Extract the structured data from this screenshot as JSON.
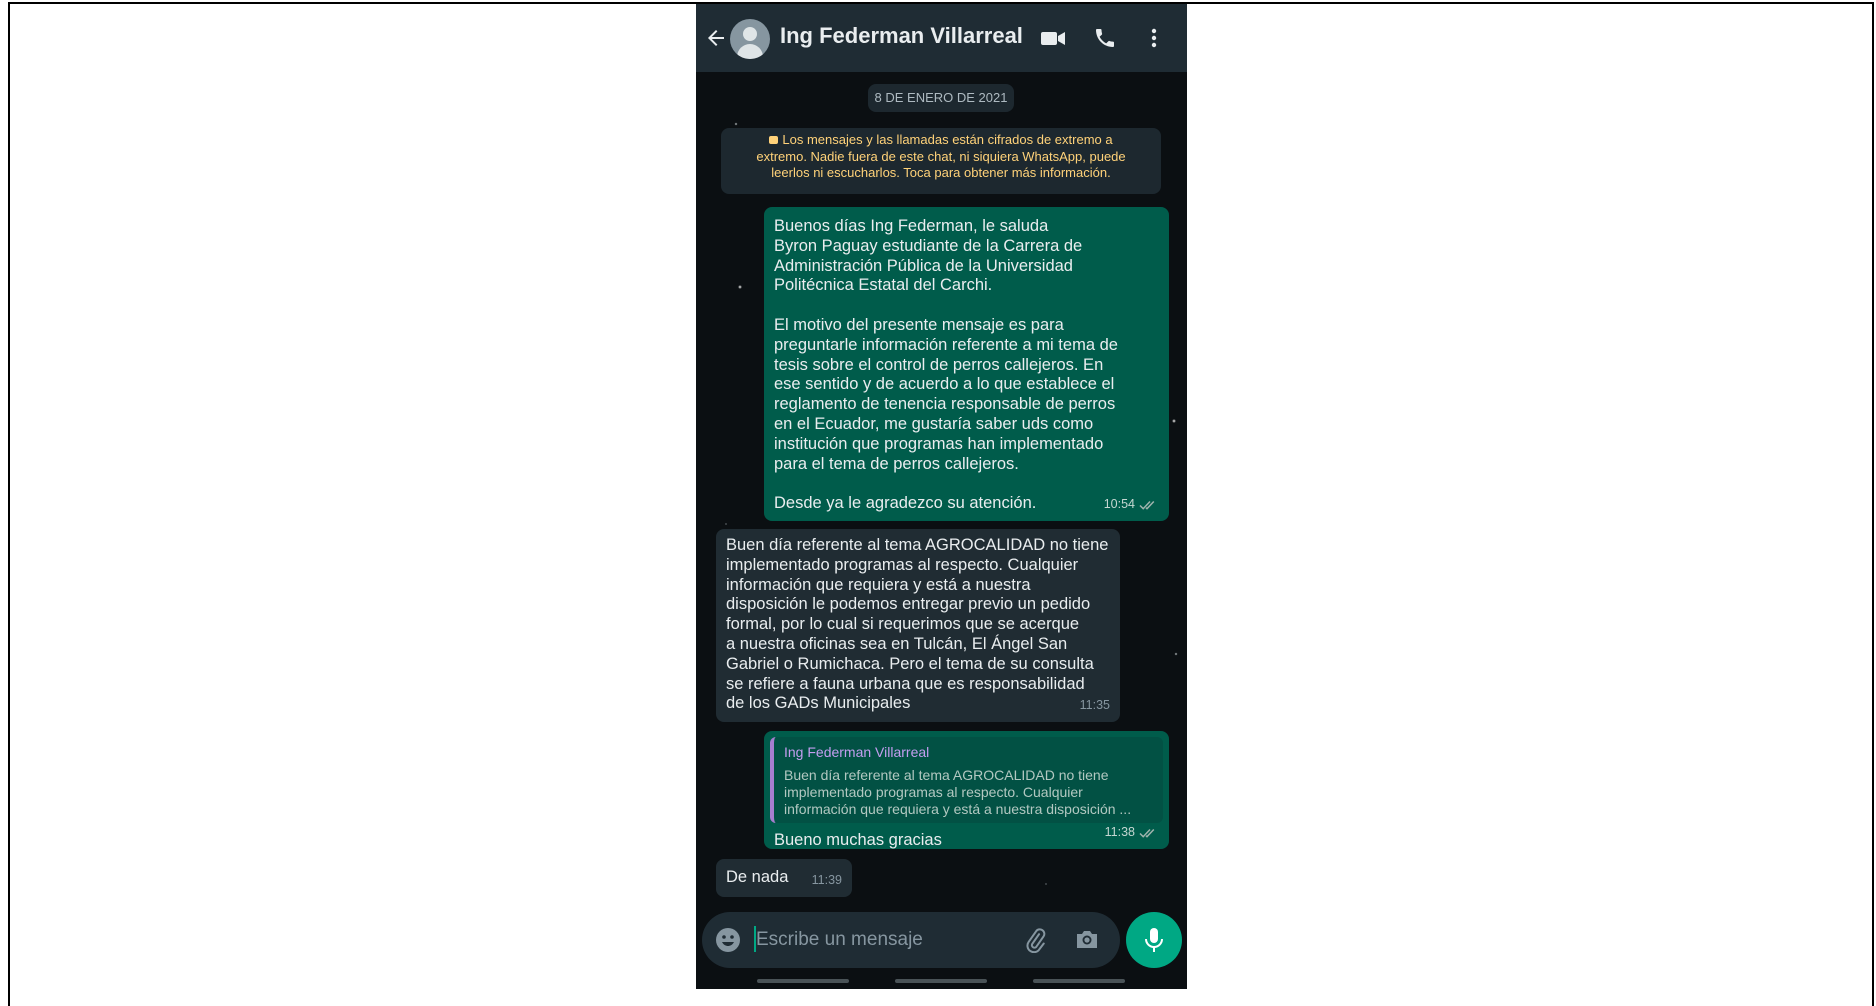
{
  "header": {
    "contact_name": "Ing Federman Villarreal",
    "back_icon": "arrow-left-icon",
    "video_icon": "video-call-icon",
    "call_icon": "phone-icon",
    "menu_icon": "more-vert-icon"
  },
  "chat": {
    "date_chip": "8 DE ENERO DE 2021",
    "encryption_notice": "Los mensajes y las llamadas están cifrados de extremo a\nextremo. Nadie fuera de este chat, ni siquiera WhatsApp, puede\nleerlos ni escucharlos. Toca para obtener más información.",
    "messages": [
      {
        "direction": "outgoing",
        "text": "Buenos días Ing Federman, le saluda\nByron Paguay estudiante de la Carrera de\nAdministración Pública de la Universidad\nPolitécnica Estatal del Carchi.\n\nEl motivo del presente mensaje es para\npreguntarle información referente a mi tema de\ntesis sobre el control de perros callejeros. En\nese sentido y de acuerdo a lo que establece el\nreglamento de tenencia responsable de perros\nen el Ecuador, me gustaría saber uds como\ninstitución que programas han implementado\npara el tema de perros callejeros.\n\nDesde ya le agradezco su atención.",
        "time": "10:54",
        "status": "read"
      },
      {
        "direction": "incoming",
        "text": "Buen día referente al tema AGROCALIDAD no tiene\nimplementado programas al respecto. Cualquier\ninformación que requiera y está a nuestra\ndisposición le podemos entregar previo un pedido\nformal, por lo cual si requerimos que se acerque\na nuestra oficinas sea en Tulcán, El Ángel San\nGabriel o Rumichaca. Pero el tema de su consulta\nse refiere a fauna urbana que es responsabilidad\nde los GADs Municipales",
        "time": "11:35"
      },
      {
        "direction": "outgoing",
        "quote_author": "Ing Federman Villarreal",
        "quote_text": "Buen día referente al tema AGROCALIDAD no tiene\nimplementado programas al respecto. Cualquier\ninformación que requiera y está a nuestra disposición ...",
        "text": "Bueno muchas gracias",
        "time": "11:38",
        "status": "read"
      },
      {
        "direction": "incoming",
        "text": "De nada",
        "time": "11:39"
      }
    ]
  },
  "composer": {
    "placeholder": "Escribe un mensaje",
    "emoji_icon": "emoji-icon",
    "attach_icon": "paperclip-icon",
    "camera_icon": "camera-icon",
    "mic_icon": "microphone-icon"
  },
  "colors": {
    "header_bg": "#1f2c34",
    "outgoing_bubble": "#005c4b",
    "incoming_bubble": "#202c33",
    "accent": "#00a884",
    "notice_text": "#ffd279"
  }
}
